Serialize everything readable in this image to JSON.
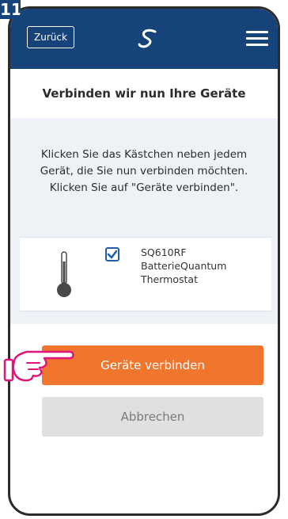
{
  "step_badge": "11",
  "header": {
    "back_label": "Zurück",
    "logo_icon": "salus-logo-icon",
    "menu_icon": "hamburger-menu-icon"
  },
  "page": {
    "title": "Verbinden wir nun Ihre Geräte",
    "instructions": [
      "Klicken Sie das Kästchen neben jedem",
      "Gerät, die Sie nun verbinden möchten.",
      "Klicken Sie auf \"Geräte verbinden\"."
    ]
  },
  "device": {
    "icon": "thermometer-icon",
    "checked": true,
    "lines": [
      "SQ610RF",
      "BatterieQuantum",
      "Thermostat"
    ]
  },
  "actions": {
    "connect_label": "Geräte verbinden",
    "cancel_label": "Abbrechen"
  },
  "colors": {
    "header_bg": "#16437a",
    "accent": "#f0762e",
    "checkbox": "#1f5ea8",
    "pointer_hand": "#e0147a"
  }
}
